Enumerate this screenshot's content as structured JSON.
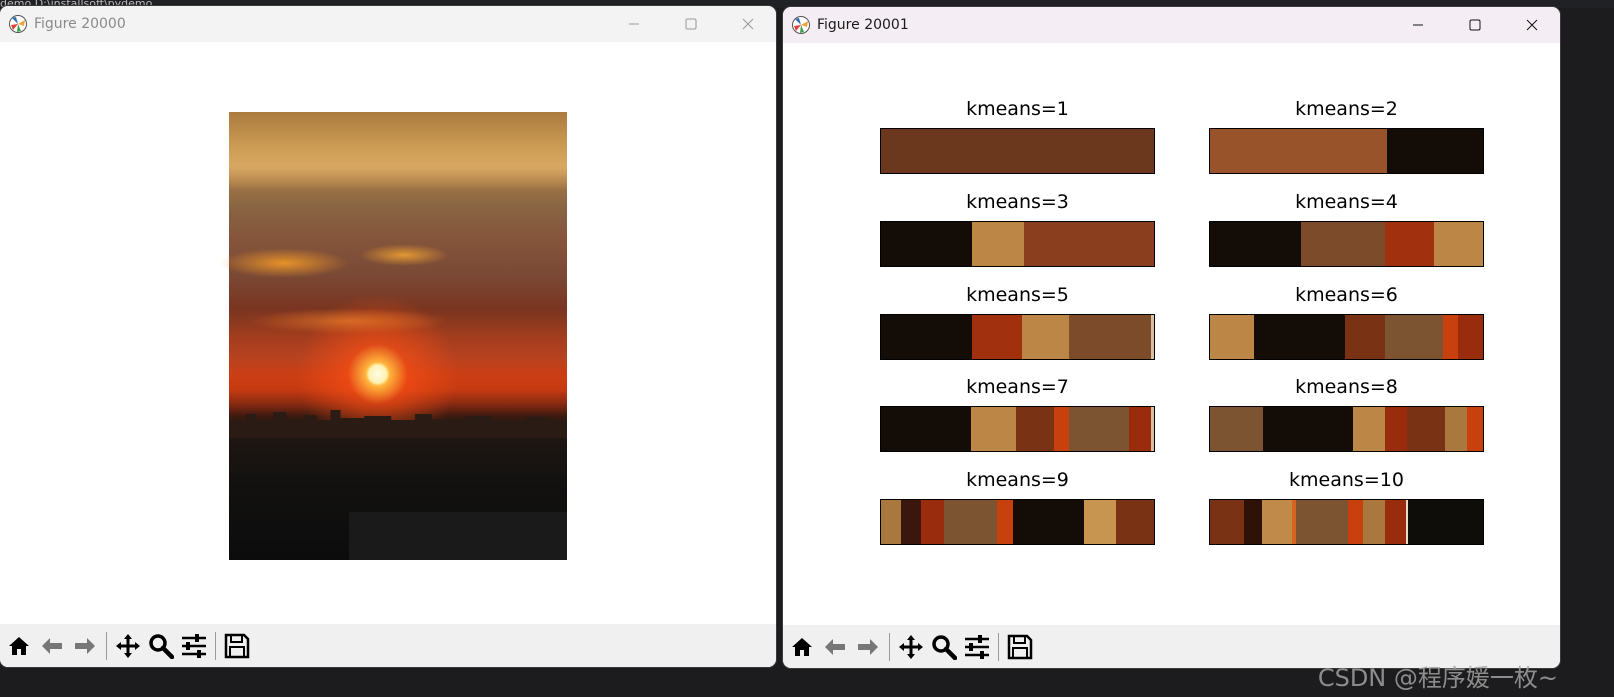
{
  "top_strip": {
    "text": "demo  D:\\installsoft\\pydemo"
  },
  "window1": {
    "title": "Figure 20000",
    "controls": {
      "minimize": "—",
      "maximize": "☐",
      "close": "✕"
    }
  },
  "window2": {
    "title": "Figure 20001",
    "controls": {
      "minimize": "—",
      "maximize": "☐",
      "close": "✕"
    },
    "plots": [
      {
        "title": "kmeans=1",
        "segments": [
          {
            "color": "#6b381d",
            "fraction": 1.0
          }
        ]
      },
      {
        "title": "kmeans=2",
        "segments": [
          {
            "color": "#98532a",
            "fraction": 0.65
          },
          {
            "color": "#140c07",
            "fraction": 0.35
          }
        ]
      },
      {
        "title": "kmeans=3",
        "segments": [
          {
            "color": "#140c07",
            "fraction": 0.335
          },
          {
            "color": "#bc8646",
            "fraction": 0.19
          },
          {
            "color": "#8a3e1e",
            "fraction": 0.475
          }
        ]
      },
      {
        "title": "kmeans=4",
        "segments": [
          {
            "color": "#140c07",
            "fraction": 0.335
          },
          {
            "color": "#7c4c2a",
            "fraction": 0.305
          },
          {
            "color": "#a0300e",
            "fraction": 0.18
          },
          {
            "color": "#bc8646",
            "fraction": 0.18
          }
        ]
      },
      {
        "title": "kmeans=5",
        "segments": [
          {
            "color": "#140c07",
            "fraction": 0.335
          },
          {
            "color": "#a0300e",
            "fraction": 0.18
          },
          {
            "color": "#bc8646",
            "fraction": 0.175
          },
          {
            "color": "#7c4c2a",
            "fraction": 0.3
          },
          {
            "color": "#d6c0a0",
            "fraction": 0.01
          }
        ]
      },
      {
        "title": "kmeans=6",
        "segments": [
          {
            "color": "#bc8646",
            "fraction": 0.16
          },
          {
            "color": "#140c07",
            "fraction": 0.335
          },
          {
            "color": "#7a3215",
            "fraction": 0.145
          },
          {
            "color": "#7c5432",
            "fraction": 0.215
          },
          {
            "color": "#c8400e",
            "fraction": 0.055
          },
          {
            "color": "#9a2c0e",
            "fraction": 0.09
          }
        ]
      },
      {
        "title": "kmeans=7",
        "segments": [
          {
            "color": "#140c07",
            "fraction": 0.33
          },
          {
            "color": "#bc8646",
            "fraction": 0.165
          },
          {
            "color": "#7a3215",
            "fraction": 0.14
          },
          {
            "color": "#c8400e",
            "fraction": 0.055
          },
          {
            "color": "#7c5432",
            "fraction": 0.22
          },
          {
            "color": "#9a2c0e",
            "fraction": 0.08
          },
          {
            "color": "#d6c0a0",
            "fraction": 0.01
          }
        ]
      },
      {
        "title": "kmeans=8",
        "segments": [
          {
            "color": "#7c5432",
            "fraction": 0.195
          },
          {
            "color": "#140c07",
            "fraction": 0.33
          },
          {
            "color": "#bc8646",
            "fraction": 0.115
          },
          {
            "color": "#9a2c0e",
            "fraction": 0.08
          },
          {
            "color": "#7a3215",
            "fraction": 0.14
          },
          {
            "color": "#a8783e",
            "fraction": 0.08
          },
          {
            "color": "#c8400e",
            "fraction": 0.06
          }
        ]
      },
      {
        "title": "kmeans=9",
        "segments": [
          {
            "color": "#a8783e",
            "fraction": 0.075
          },
          {
            "color": "#3a160c",
            "fraction": 0.07
          },
          {
            "color": "#9a2c0e",
            "fraction": 0.085
          },
          {
            "color": "#7c5432",
            "fraction": 0.195
          },
          {
            "color": "#c8400e",
            "fraction": 0.06
          },
          {
            "color": "#140c07",
            "fraction": 0.26
          },
          {
            "color": "#c89550",
            "fraction": 0.115
          },
          {
            "color": "#7a3215",
            "fraction": 0.14
          }
        ]
      },
      {
        "title": "kmeans=10",
        "segments": [
          {
            "color": "#7a3215",
            "fraction": 0.125
          },
          {
            "color": "#2e1208",
            "fraction": 0.065
          },
          {
            "color": "#c08a4a",
            "fraction": 0.11
          },
          {
            "color": "#d6641e",
            "fraction": 0.015
          },
          {
            "color": "#7c5432",
            "fraction": 0.19
          },
          {
            "color": "#c8400e",
            "fraction": 0.055
          },
          {
            "color": "#a8783e",
            "fraction": 0.08
          },
          {
            "color": "#9a2c0e",
            "fraction": 0.08
          },
          {
            "color": "#e8dcc8",
            "fraction": 0.005
          },
          {
            "color": "#0f0d0a",
            "fraction": 0.275
          }
        ]
      }
    ]
  },
  "toolbar": {
    "icons": [
      "home-icon",
      "back-icon",
      "forward-icon",
      "pan-icon",
      "zoom-icon",
      "configure-subplots-icon",
      "save-icon"
    ]
  },
  "watermark": "CSDN @程序媛一枚~"
}
